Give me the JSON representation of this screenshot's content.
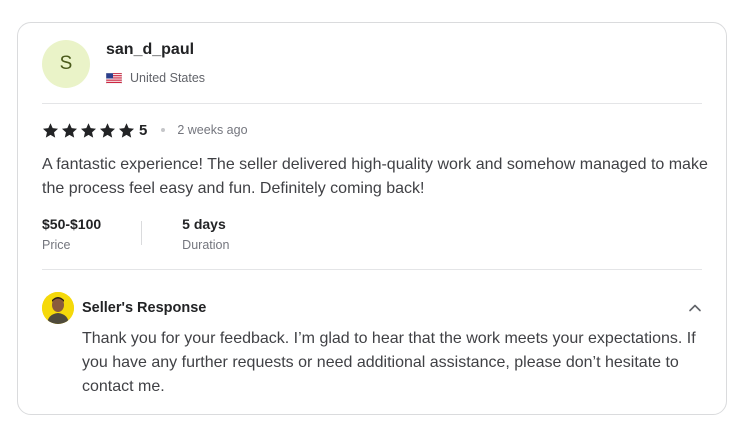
{
  "reviewer": {
    "avatar_letter": "S",
    "username": "san_d_paul",
    "country": "United States",
    "flag_icon": "us-flag-icon"
  },
  "rating": {
    "stars": 5,
    "value": "5",
    "time_ago": "2 weeks ago"
  },
  "review": {
    "text": "A fantastic experience! The seller delivered high-quality work and somehow managed to make the process feel easy and fun. Definitely coming back!"
  },
  "meta": {
    "price_value": "$50-$100",
    "price_label": "Price",
    "duration_value": "5 days",
    "duration_label": "Duration"
  },
  "response": {
    "title": "Seller's Response",
    "text": "Thank you for your feedback. I’m glad to hear that the work meets your expectations. If you have any further requests or need additional assistance, please don’t hesitate to contact me."
  },
  "colors": {
    "star": "#222325",
    "avatar_bg": "#eaf3c8",
    "seller_avatar_bg": "#f5d90a"
  }
}
